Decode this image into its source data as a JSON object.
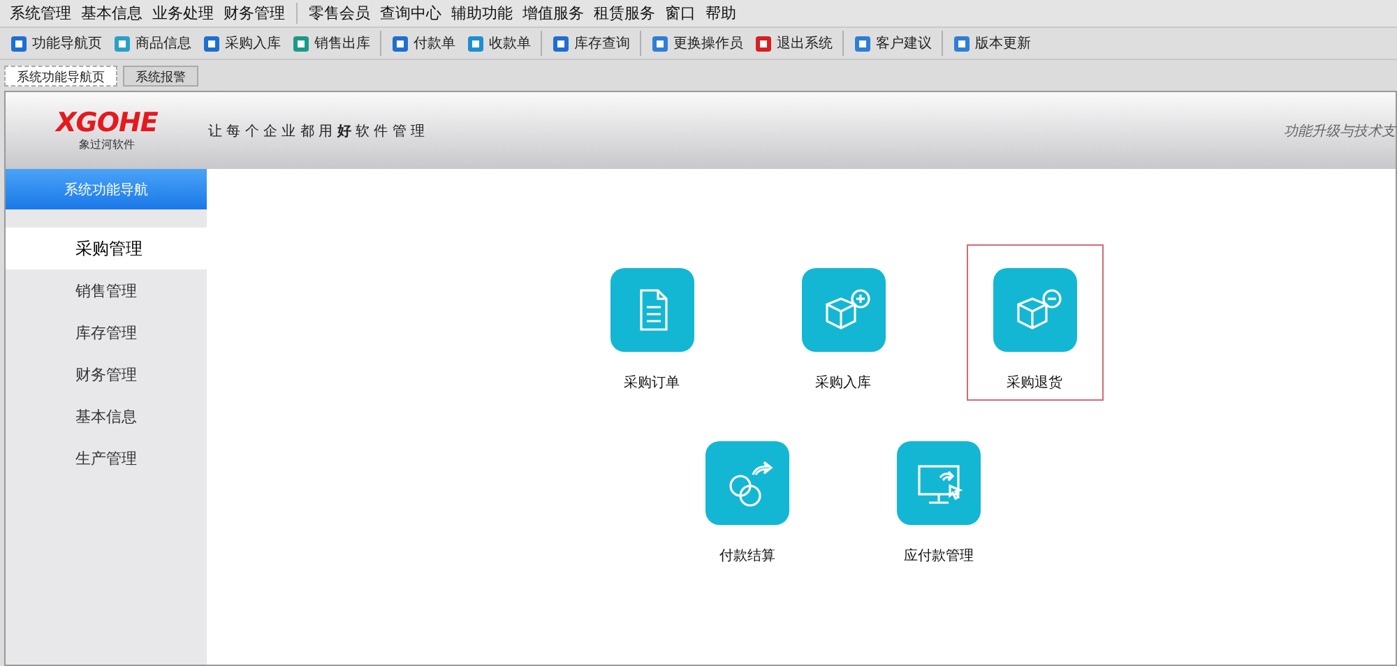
{
  "menu_bar": {
    "groups": [
      [
        "系统管理",
        "基本信息",
        "业务处理",
        "财务管理"
      ],
      [
        "零售会员",
        "查询中心",
        "辅助功能",
        "增值服务",
        "租赁服务",
        "窗口",
        "帮助"
      ]
    ]
  },
  "toolbar": {
    "groups": [
      [
        "功能导航页",
        "商品信息",
        "采购入库",
        "销售出库"
      ],
      [
        "付款单",
        "收款单"
      ],
      [
        "库存查询"
      ],
      [
        "更换操作员",
        "退出系统"
      ],
      [
        "客户建议"
      ],
      [
        "版本更新"
      ]
    ]
  },
  "tabs": [
    {
      "label": "系统功能导航页",
      "selected": true
    },
    {
      "label": "系统报警",
      "selected": false
    }
  ],
  "header": {
    "logo": "XGOHE",
    "logo_subtitle": "象过河软件",
    "slogan": "让 每 个 企 业 都 用 **好** 软 件 管 理",
    "right_text": "功能升级与技术支"
  },
  "sidebar": {
    "title": "系统功能导航",
    "items": [
      {
        "label": "采购管理",
        "selected": true
      },
      {
        "label": "销售管理",
        "selected": false
      },
      {
        "label": "库存管理",
        "selected": false
      },
      {
        "label": "财务管理",
        "selected": false
      },
      {
        "label": "基本信息",
        "selected": false
      },
      {
        "label": "生产管理",
        "selected": false
      }
    ]
  },
  "tiles": [
    [
      {
        "label": "采购订单",
        "kind": "document",
        "selected": false
      },
      {
        "label": "采购入库",
        "kind": "box-plus",
        "selected": false
      },
      {
        "label": "采购退货",
        "kind": "box-minus",
        "selected": true
      }
    ],
    [
      {
        "label": "付款结算",
        "kind": "coins",
        "selected": false
      },
      {
        "label": "应付款管理",
        "kind": "monitor",
        "selected": false
      }
    ]
  ]
}
